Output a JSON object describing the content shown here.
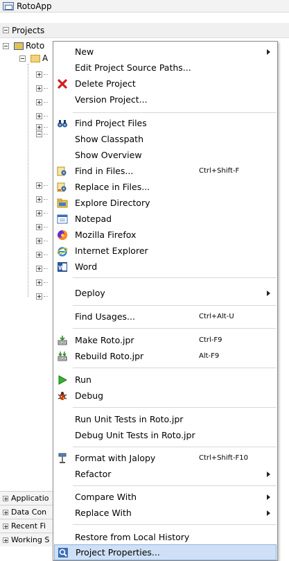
{
  "app": {
    "title": "RotoApp"
  },
  "projects_header": "Projects",
  "tree": {
    "root_label": "Roto",
    "child_label": "A"
  },
  "bottom_panels": [
    "Applicatio",
    "Data Con",
    "Recent Fi",
    "Working S"
  ],
  "menu": {
    "items": [
      {
        "label": "New",
        "icon": "none",
        "submenu": true
      },
      {
        "label": "Edit Project Source Paths...",
        "icon": "none"
      },
      {
        "label": "Delete Project",
        "icon": "delete-x-icon"
      },
      {
        "label": "Version Project...",
        "icon": "none"
      },
      {
        "label": "Find Project Files",
        "icon": "binoculars-icon"
      },
      {
        "label": "Show Classpath",
        "icon": "none"
      },
      {
        "label": "Show Overview",
        "icon": "none"
      },
      {
        "label": "Find in Files...",
        "icon": "find-in-files-icon",
        "shortcut": "Ctrl+Shift-F"
      },
      {
        "label": "Replace in Files...",
        "icon": "replace-in-files-icon"
      },
      {
        "label": "Explore Directory",
        "icon": "explore-directory-icon"
      },
      {
        "label": "Notepad",
        "icon": "notepad-icon"
      },
      {
        "label": "Mozilla Firefox",
        "icon": "firefox-icon"
      },
      {
        "label": "Internet Explorer",
        "icon": "internet-explorer-icon"
      },
      {
        "label": "Word",
        "icon": "word-icon"
      },
      {
        "label": "Deploy",
        "icon": "none",
        "submenu": true
      },
      {
        "label": "Find Usages...",
        "icon": "none",
        "shortcut": "Ctrl+Alt-U"
      },
      {
        "label": "Make Roto.jpr",
        "icon": "make-icon",
        "shortcut": "Ctrl-F9"
      },
      {
        "label": "Rebuild Roto.jpr",
        "icon": "rebuild-icon",
        "shortcut": "Alt-F9"
      },
      {
        "label": "Run",
        "icon": "run-icon"
      },
      {
        "label": "Debug",
        "icon": "debug-icon"
      },
      {
        "label": "Run Unit Tests in Roto.jpr",
        "icon": "none"
      },
      {
        "label": "Debug Unit Tests in Roto.jpr",
        "icon": "none"
      },
      {
        "label": "Format with Jalopy",
        "icon": "jalopy-icon",
        "shortcut": "Ctrl+Shift-F10"
      },
      {
        "label": "Refactor",
        "icon": "none",
        "submenu": true
      },
      {
        "label": "Compare With",
        "icon": "none",
        "submenu": true
      },
      {
        "label": "Replace With",
        "icon": "none",
        "submenu": true
      },
      {
        "label": "Restore from Local History",
        "icon": "none"
      },
      {
        "label": "Project Properties...",
        "icon": "project-properties-icon",
        "selected": true
      }
    ]
  },
  "colors": {
    "selection": "#cfe0f6",
    "selection_border": "#8cb1e0",
    "folder": "#f3d27a"
  }
}
